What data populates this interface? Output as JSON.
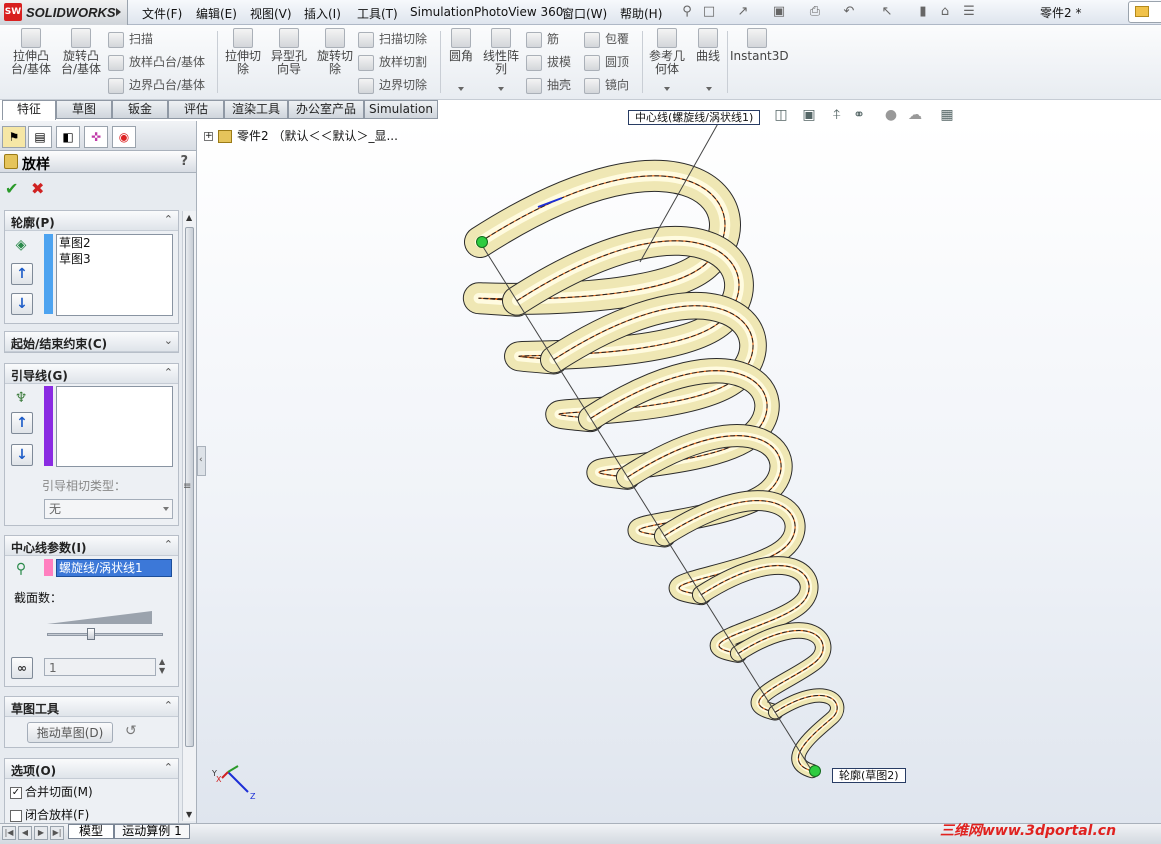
{
  "app": {
    "logo_text": "SOLIDWORKS",
    "logo_badge": "SW",
    "doc_title": "零件2 *"
  },
  "menu": [
    "文件(F)",
    "编辑(E)",
    "视图(V)",
    "插入(I)",
    "工具(T)",
    "Simulation",
    "PhotoView 360",
    "窗口(W)",
    "帮助(H)"
  ],
  "toolbar": {
    "big": [
      {
        "label": "拉伸凸\n台/基体"
      },
      {
        "label": "旋转凸\n台/基体"
      },
      {
        "label": "拉伸切\n除"
      },
      {
        "label": "异型孔\n向导"
      },
      {
        "label": "旋转切\n除"
      },
      {
        "label": "圆角"
      },
      {
        "label": "线性阵\n列"
      },
      {
        "label": "参考几\n何体"
      },
      {
        "label": "曲线"
      },
      {
        "label": "Instant3D"
      }
    ],
    "small": [
      "扫描",
      "放样凸台/基体",
      "边界凸台/基体",
      "扫描切除",
      "放样切割",
      "边界切除",
      "筋",
      "拔模",
      "抽壳",
      "包覆",
      "圆顶",
      "镜向"
    ]
  },
  "tabs": [
    "特征",
    "草图",
    "钣金",
    "评估",
    "渲染工具",
    "办公室产品",
    "Simulation"
  ],
  "property_manager": {
    "title": "放样",
    "help": "?",
    "profiles": {
      "header": "轮廓(P)",
      "items": [
        "草图2",
        "草图3"
      ]
    },
    "constraints": {
      "header": "起始/结束约束(C)"
    },
    "guides": {
      "header": "引导线(G)",
      "tangency_label": "引导相切类型：",
      "tangency_value": "无"
    },
    "centerline": {
      "header": "中心线参数(I)",
      "value": "螺旋线/涡状线1",
      "sections_label": "截面数：",
      "sections_value": "1"
    },
    "sketch_tools": {
      "header": "草图工具",
      "drag_button": "拖动草图(D)"
    },
    "options": {
      "header": "选项(O)",
      "merge_tangent": "合并切面(M)",
      "merge_checked": true,
      "close_loft": "闭合放样(F)",
      "close_checked": false
    }
  },
  "graphics": {
    "tree_root": "零件2 （默认＜＜默认＞_显...",
    "callout_centerline": "中心线(螺旋线/涡状线1)",
    "callout_profile": "轮廓(草图2)"
  },
  "bottom_tabs": [
    "模型",
    "运动算例 1"
  ],
  "watermark": "三维网www.3dportal.cn"
}
